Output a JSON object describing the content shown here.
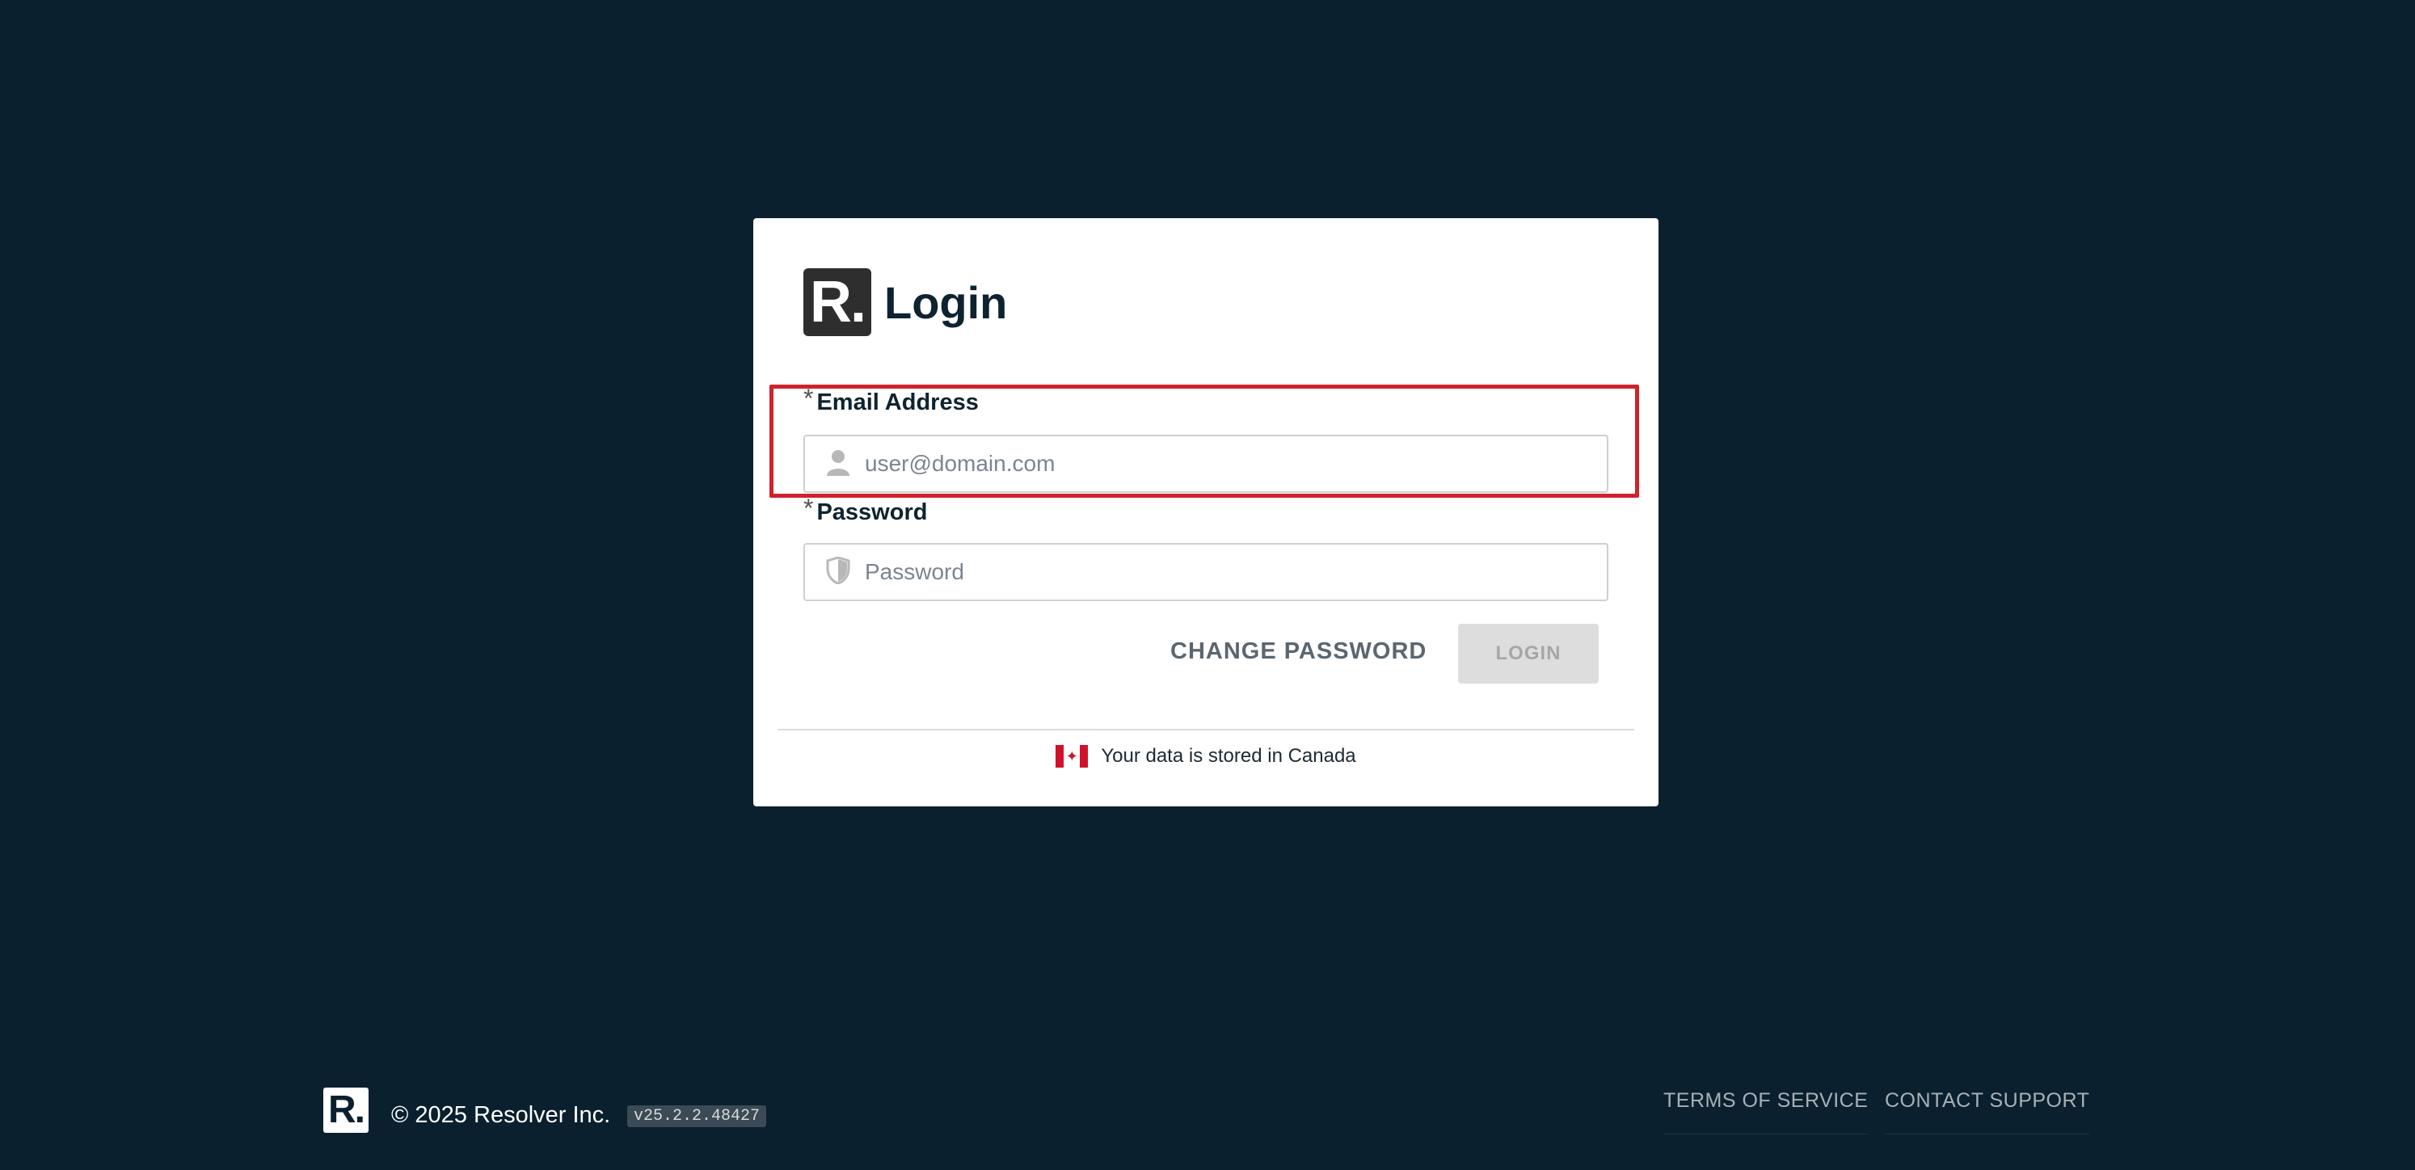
{
  "login": {
    "logo_letter": "R.",
    "title": "Login",
    "email": {
      "required_mark": "*",
      "label": "Email Address",
      "placeholder": "user@domain.com",
      "value": ""
    },
    "password": {
      "required_mark": "*",
      "label": "Password",
      "placeholder": "Password",
      "value": ""
    },
    "change_password_label": "CHANGE PASSWORD",
    "login_button_label": "LOGIN",
    "storage_note": "Your data is stored in Canada",
    "flag_leaf": "✦"
  },
  "footer": {
    "logo_letter": "R.",
    "copyright": "© 2025 Resolver Inc.",
    "version": "v25.2.2.48427",
    "terms_label": "TERMS OF SERVICE",
    "support_label": "CONTACT SUPPORT"
  },
  "colors": {
    "background": "#0a202e",
    "highlight": "#d0222a",
    "canada_red": "#d0122a"
  },
  "icons": {
    "email_field": "user-icon",
    "password_field": "shield-icon",
    "flag": "canada-flag-icon"
  }
}
